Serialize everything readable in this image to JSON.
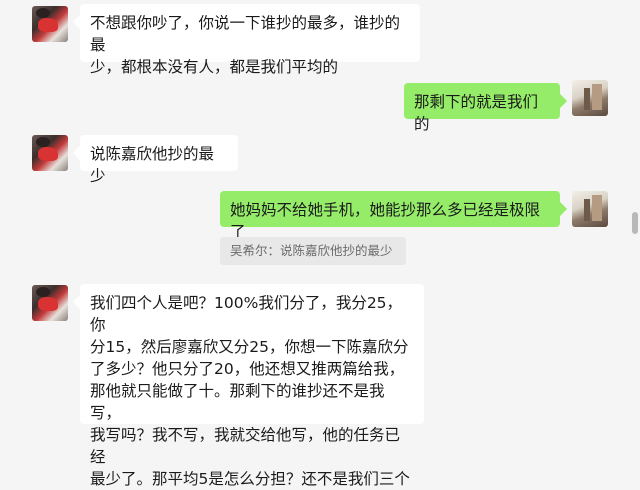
{
  "chat": {
    "messages": [
      {
        "side": "in",
        "text": "不想跟你吵了，你说一下谁抄的最多，谁抄的最\n少，都根本没有人，都是我们平均的"
      },
      {
        "side": "out",
        "text": "那剩下的就是我们的"
      },
      {
        "side": "in",
        "text": "说陈嘉欣他抄的最少"
      },
      {
        "side": "out",
        "text": "她妈妈不给她手机，她能抄那么多已经是极限了"
      },
      {
        "side": "quote",
        "text": "吴希尔：说陈嘉欣他抄的最少"
      },
      {
        "side": "in",
        "text": "我们四个人是吧？100%我们分了，我分25，你\n分15，然后廖嘉欣又分25，你想一下陈嘉欣分\n了多少？他只分了20，他还想又推两篇给我，\n那他就只能做了十。那剩下的谁抄还不是我写，\n我写吗？我不写，我就交给他写，他的任务已经\n最少了。那平均5是怎么分担？还不是我们三个"
      }
    ]
  },
  "colors": {
    "background": "#f5f5f5",
    "incoming_bubble": "#ffffff",
    "outgoing_bubble": "#95ec69",
    "quote_bubble": "#e8e8e8"
  }
}
